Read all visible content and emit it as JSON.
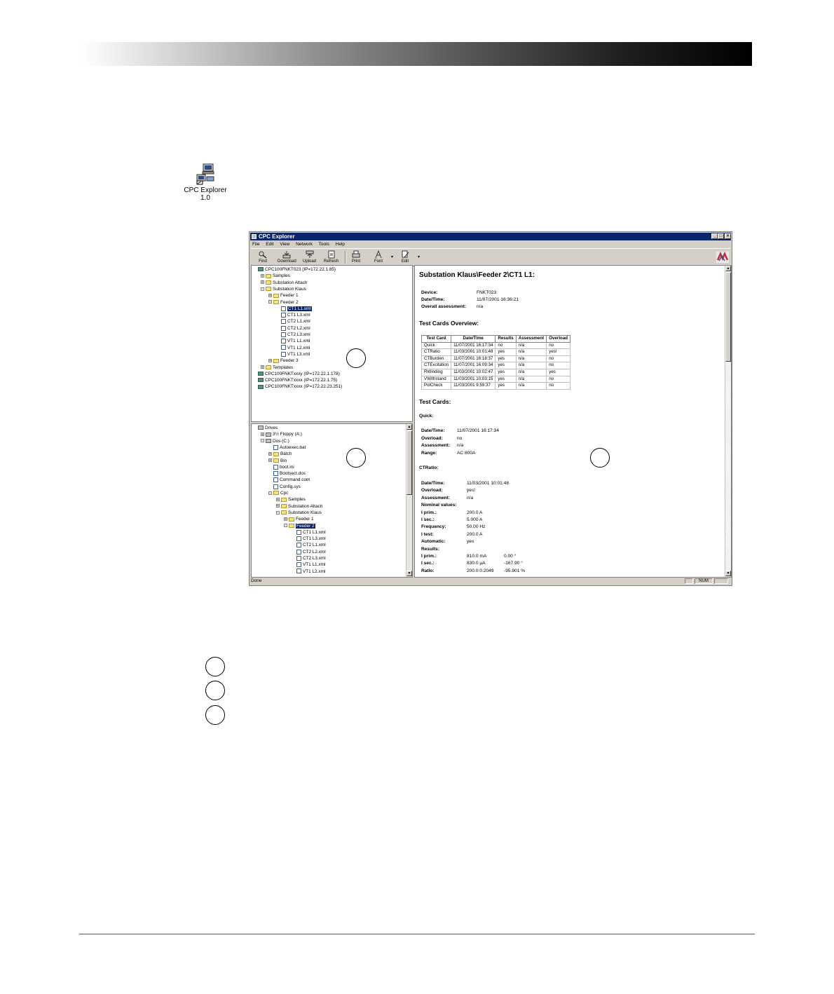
{
  "desktop_icon": {
    "label_line1": "CPC Explorer",
    "label_line2": "1.0"
  },
  "window": {
    "title": "CPC Explorer",
    "menu": [
      "File",
      "Edit",
      "View",
      "Network",
      "Tools",
      "Help"
    ],
    "toolbar": [
      "Find",
      "Download",
      "Upload",
      "Refresh",
      "Print",
      "Font",
      "Edit"
    ]
  },
  "device_tree": [
    {
      "label": "CPC100FNKT023  (IP=172.22.1.85)",
      "icon": "device-icon",
      "expander": "",
      "indent": 0
    },
    {
      "label": "Samples",
      "icon": "folder-icon",
      "expander": "+",
      "indent": 1
    },
    {
      "label": "Substation Altach",
      "icon": "folder-icon",
      "expander": "+",
      "indent": 1
    },
    {
      "label": "Substation Klaus",
      "icon": "folder-icon",
      "expander": "-",
      "indent": 1
    },
    {
      "label": "Feeder 1",
      "icon": "folder-icon",
      "expander": "+",
      "indent": 2
    },
    {
      "label": "Feeder 2",
      "icon": "folder-icon",
      "expander": "-",
      "indent": 2
    },
    {
      "label": "CT1 L1.xml",
      "icon": "xml-file-icon",
      "expander": "",
      "indent": 3,
      "selected": true
    },
    {
      "label": "CT1 L3.xml",
      "icon": "xml-file-icon",
      "expander": "",
      "indent": 3
    },
    {
      "label": "CT2 L1.xml",
      "icon": "xml-file-icon",
      "expander": "",
      "indent": 3
    },
    {
      "label": "CT2 L2.xml",
      "icon": "xml-file-icon",
      "expander": "",
      "indent": 3
    },
    {
      "label": "CT2 L3.xml",
      "icon": "xml-file-icon",
      "expander": "",
      "indent": 3
    },
    {
      "label": "VT1 L1.xml",
      "icon": "xml-file-icon",
      "expander": "",
      "indent": 3
    },
    {
      "label": "VT1 L2.xml",
      "icon": "xml-file-icon",
      "expander": "",
      "indent": 3
    },
    {
      "label": "VT1 L3.xml",
      "icon": "xml-file-icon",
      "expander": "",
      "indent": 3
    },
    {
      "label": "Feeder 3",
      "icon": "folder-icon",
      "expander": "+",
      "indent": 2
    },
    {
      "label": "Templates",
      "icon": "folder-icon",
      "expander": "+",
      "indent": 1
    },
    {
      "label": "CPC100FNKTxxxy  (IP=172.22.1.178)",
      "icon": "device-icon",
      "expander": "",
      "indent": 0
    },
    {
      "label": "CPC100FNKTxxxx  (IP=172.22.1.75)",
      "icon": "device-icon",
      "expander": "",
      "indent": 0
    },
    {
      "label": "CPC100FNKTxxxx  (IP=172.22.23.251)",
      "icon": "device-icon",
      "expander": "",
      "indent": 0
    }
  ],
  "drive_tree": [
    {
      "label": "Drives",
      "icon": "computer-icon",
      "expander": "",
      "indent": 0
    },
    {
      "label": "3½ Floppy (A:)",
      "icon": "drive-icon",
      "expander": "+",
      "indent": 1
    },
    {
      "label": "Dos (C:)",
      "icon": "drive-icon",
      "expander": "-",
      "indent": 1
    },
    {
      "label": "Autoexec.bat",
      "icon": "file-icon",
      "expander": "",
      "indent": 2
    },
    {
      "label": "Batch",
      "icon": "folder-icon",
      "expander": "+",
      "indent": 2
    },
    {
      "label": "Bin",
      "icon": "folder-icon",
      "expander": "+",
      "indent": 2
    },
    {
      "label": "boot.ini",
      "icon": "file-icon",
      "expander": "",
      "indent": 2
    },
    {
      "label": "Bootsect.dos",
      "icon": "file-icon",
      "expander": "",
      "indent": 2
    },
    {
      "label": "Command.com",
      "icon": "file-icon",
      "expander": "",
      "indent": 2
    },
    {
      "label": "Config.sys",
      "icon": "file-icon",
      "expander": "",
      "indent": 2
    },
    {
      "label": "Cpc",
      "icon": "folder-icon",
      "expander": "-",
      "indent": 2
    },
    {
      "label": "Samples",
      "icon": "folder-icon",
      "expander": "+",
      "indent": 3
    },
    {
      "label": "Substation Altach",
      "icon": "folder-icon",
      "expander": "+",
      "indent": 3
    },
    {
      "label": "Substation Klaus",
      "icon": "folder-icon",
      "expander": "-",
      "indent": 3
    },
    {
      "label": "Feeder 1",
      "icon": "folder-icon",
      "expander": "+",
      "indent": 4
    },
    {
      "label": "Feeder 2",
      "icon": "folder-icon",
      "expander": "-",
      "indent": 4,
      "selected": true
    },
    {
      "label": "CT1 L1.xml",
      "icon": "xml-file-icon",
      "expander": "",
      "indent": 5
    },
    {
      "label": "CT1 L3.xml",
      "icon": "xml-file-icon",
      "expander": "",
      "indent": 5
    },
    {
      "label": "CT2 L1.xml",
      "icon": "xml-file-icon",
      "expander": "",
      "indent": 5
    },
    {
      "label": "CT2 L2.xml",
      "icon": "xml-file-icon",
      "expander": "",
      "indent": 5
    },
    {
      "label": "CT2 L3.xml",
      "icon": "xml-file-icon",
      "expander": "",
      "indent": 5
    },
    {
      "label": "VT1 L1.xml",
      "icon": "xml-file-icon",
      "expander": "",
      "indent": 5
    },
    {
      "label": "VT1 L2.xml",
      "icon": "xml-file-icon",
      "expander": "",
      "indent": 5
    }
  ],
  "report": {
    "heading": "Substation Klaus\\Feeder 2\\CT1 L1:",
    "device_label": "Device:",
    "device_value": "FNKT023",
    "datetime_label": "Date/Time:",
    "datetime_value": "11/07/2001 16:36:21",
    "assessment_label": "Overall assessment:",
    "assessment_value": "n/a",
    "overview_heading": "Test Cards Overview:",
    "table_headers": [
      "Test Card",
      "Date/Time",
      "Results",
      "Assessment",
      "Overload"
    ],
    "table_rows": [
      [
        "Quick",
        "11/07/2001 16:17:34",
        "no",
        "n/a",
        "no"
      ],
      [
        "CTRatio",
        "11/03/2001 10:01:48",
        "yes",
        "n/a",
        "yes!"
      ],
      [
        "CTBurden",
        "11/07/2001 16:18:37",
        "yes",
        "n/a",
        "no"
      ],
      [
        "CTExcitation",
        "11/07/2001 16:09:34",
        "yes",
        "n/a",
        "no"
      ],
      [
        "RWinding",
        "11/03/2001 10:02:47",
        "yes",
        "n/a",
        "yes"
      ],
      [
        "VWithstand",
        "11/03/2001 10:03:15",
        "yes",
        "n/a",
        "no"
      ],
      [
        "PolCheck",
        "11/03/2001 9:59:37",
        "yes",
        "n/a",
        "no"
      ]
    ],
    "cards_heading": "Test Cards:",
    "quick": {
      "title": "Quick:",
      "rows": [
        [
          "Date/Time:",
          "11/07/2001 16:17:34"
        ],
        [
          "Overload:",
          "no"
        ],
        [
          "Assessment:",
          "n/a"
        ],
        [
          "Range:",
          "AC 800A"
        ]
      ]
    },
    "ctratio": {
      "title": "CTRatio:",
      "rows": [
        [
          "Date/Time:",
          "11/03/2001 10:01:48",
          ""
        ],
        [
          "Overload:",
          "yes!",
          ""
        ],
        [
          "Assessment:",
          "n/a",
          ""
        ],
        [
          "Nominal values:",
          "",
          ""
        ],
        [
          "I prim.:",
          "200.0 A",
          ""
        ],
        [
          "I sec.:",
          "5.000 A",
          ""
        ],
        [
          "Frequency:",
          "50.00 Hz",
          ""
        ],
        [
          "I test:",
          "200.0 A",
          ""
        ],
        [
          "Automatic:",
          "yes",
          ""
        ],
        [
          "Results:",
          "",
          ""
        ],
        [
          "I prim.:",
          "810.0 mA",
          "0.00 °"
        ],
        [
          "I sec.:",
          "830.0 µA",
          "-167.90 °"
        ],
        [
          "Ratio:",
          "200.0:0.2049",
          "-95.901 %"
        ]
      ]
    }
  },
  "status": {
    "text": "Done",
    "num": "NUM"
  }
}
